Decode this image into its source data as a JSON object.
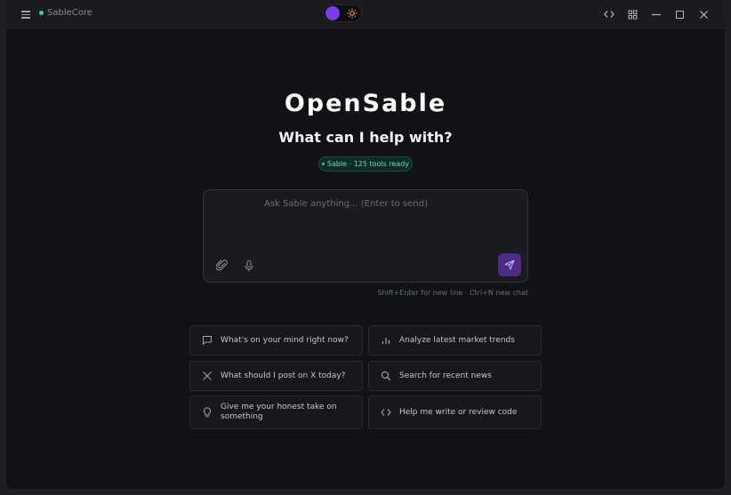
{
  "titlebar": {
    "app_name": "SableCore",
    "icons": [
      "menu-icon",
      "code-icon",
      "grid-icon",
      "minimize-icon",
      "maximize-icon",
      "close-icon"
    ]
  },
  "theme_toggle": {
    "state": "dark",
    "accent": "#7c3aed"
  },
  "hero": {
    "logo_text": "OpenSable",
    "headline": "What can I help with?",
    "status": "Sable · 125 tools ready"
  },
  "composer": {
    "placeholder": "Ask Sable anything... (Enter to send)",
    "value": "",
    "hint": "Shift+Enter for new line · Ctrl+N new chat"
  },
  "suggestions": [
    {
      "label": "What's on your mind right now?",
      "icon": "chat-bubble-icon"
    },
    {
      "label": "Analyze latest market trends",
      "icon": "bar-chart-icon"
    },
    {
      "label": "What should I post on X today?",
      "icon": "x-logo-icon"
    },
    {
      "label": "Search for recent news",
      "icon": "search-icon"
    },
    {
      "label": "Give me your honest take on something",
      "icon": "lightbulb-icon"
    },
    {
      "label": "Help me write or review code",
      "icon": "code-icon"
    }
  ],
  "colors": {
    "background": "#111216",
    "surface": "#1a1b20",
    "accent": "#7c3aed",
    "status": "#2dd4a3"
  }
}
